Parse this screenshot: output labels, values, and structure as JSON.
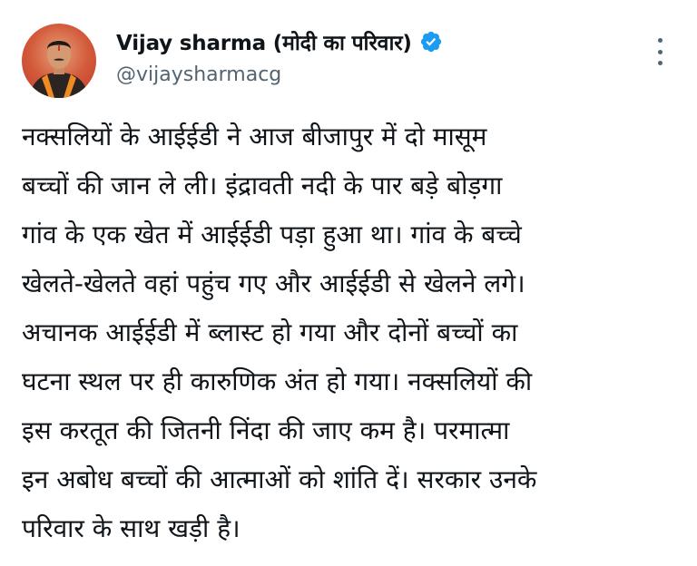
{
  "tweet": {
    "author": {
      "display_name": "Vijay sharma (मोदी का परिवार)",
      "handle": "@vijaysharmacg",
      "verified": true,
      "verified_icon": "verified-badge-icon",
      "verified_color": "#1d9bf0",
      "avatar_icon": "profile-avatar"
    },
    "more_icon": "more-options-icon",
    "text_lines": [
      "नक्सलियों के आईईडी ने आज बीजापुर में दो मासूम",
      "बच्चों की जान ले ली। इंद्रावती नदी के पार बड़े बोड़गा",
      "गांव के एक खेत में आईईडी पड़ा हुआ था। गांव के बच्चे",
      "खेलते-खेलते वहां पहुंच गए और आईईडी से खेलने लगे।",
      "अचानक आईईडी में ब्लास्ट हो गया और दोनों बच्चों का",
      "घटना स्थल पर ही कारुणिक अंत हो गया। नक्सलियों की",
      "इस करतूत की जितनी निंदा की जाए कम है। परमात्मा",
      "इन अबोध बच्चों की आत्माओं को शांति दें। सरकार उनके",
      "परिवार के साथ खड़ी है।"
    ]
  },
  "colors": {
    "text": "#0f1419",
    "secondary_text": "#536471",
    "accent": "#1d9bf0",
    "avatar_background": "#c1392b"
  }
}
